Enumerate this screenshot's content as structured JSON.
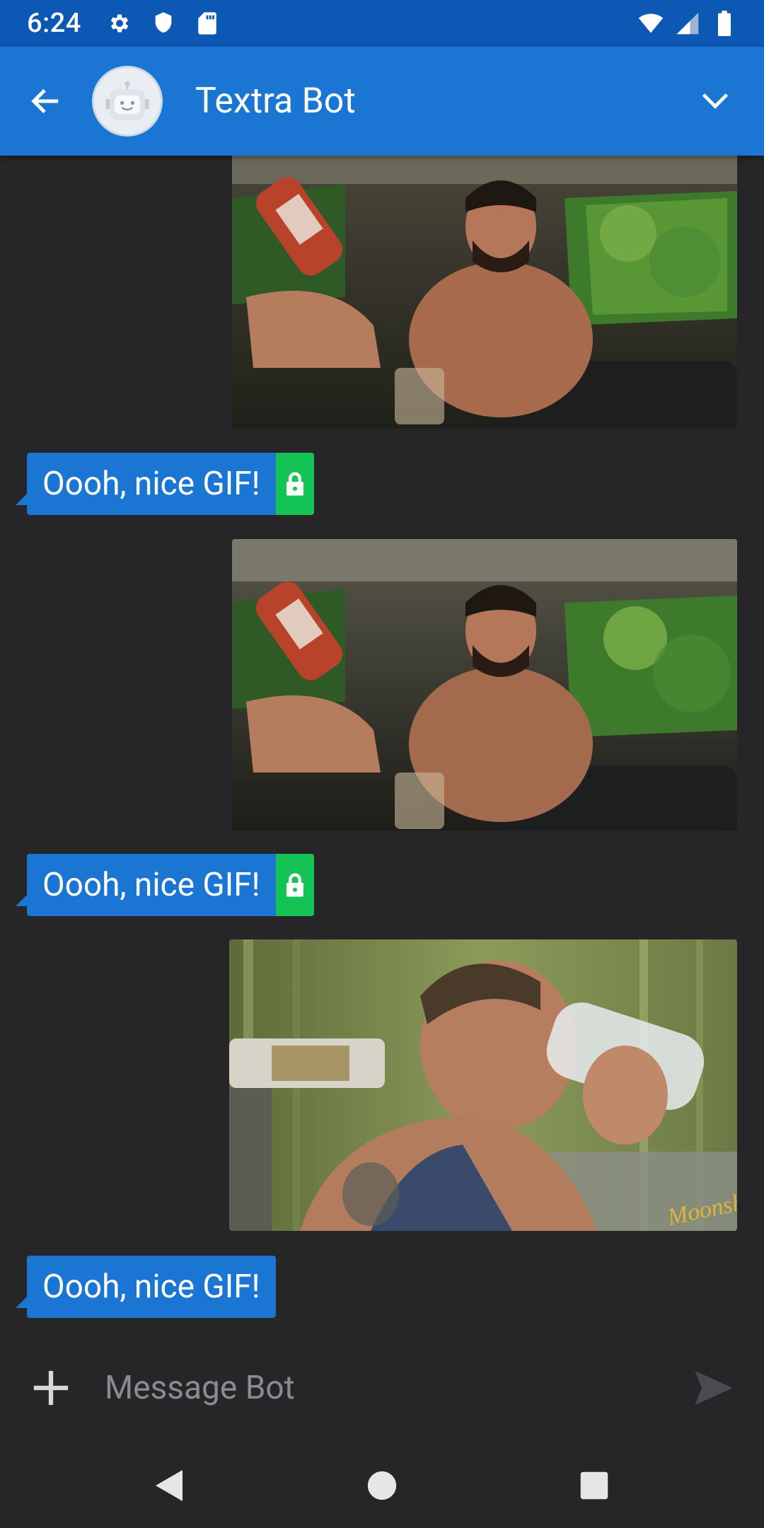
{
  "status_bar": {
    "time": "6:24",
    "left_icons": [
      "settings-icon",
      "shield-icon",
      "sd-card-icon"
    ],
    "right_icons": [
      "wifi-icon",
      "signal-icon",
      "battery-icon"
    ],
    "background": "#0d57b5"
  },
  "app_bar": {
    "title": "Textra Bot",
    "back_icon": "arrow-left-icon",
    "avatar_icon": "robot-icon",
    "menu_icon": "chevron-down-icon",
    "background": "#1a76d2"
  },
  "messages": [
    {
      "type": "gif",
      "direction": "outgoing",
      "description": "man pouring drink in car"
    },
    {
      "type": "text",
      "direction": "incoming",
      "text": "Oooh, nice GIF!",
      "locked": true
    },
    {
      "type": "gif",
      "direction": "outgoing",
      "description": "man pouring drink in car"
    },
    {
      "type": "text",
      "direction": "incoming",
      "text": "Oooh, nice GIF!",
      "locked": true
    },
    {
      "type": "gif",
      "direction": "outgoing",
      "description": "man drinking from jug",
      "watermark": "Moonshiners"
    },
    {
      "type": "text",
      "direction": "incoming",
      "text": "Oooh, nice GIF!",
      "locked": false
    }
  ],
  "composer": {
    "placeholder": "Message Bot",
    "value": "",
    "plus_icon": "plus-icon",
    "send_icon": "send-icon"
  },
  "nav_bar": {
    "buttons": [
      "back-triangle-icon",
      "home-circle-icon",
      "recents-square-icon"
    ]
  },
  "colors": {
    "background": "#262628",
    "bubble": "#1a76d2",
    "lock": "#13c455",
    "placeholder": "#8a8b8e"
  }
}
